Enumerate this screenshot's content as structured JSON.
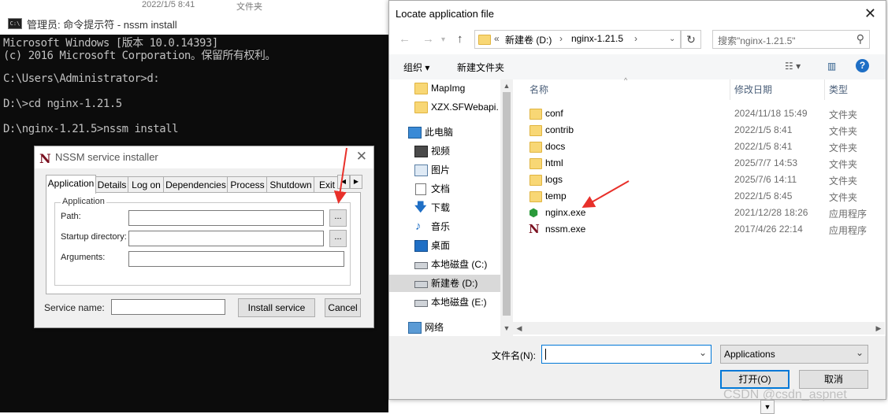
{
  "console": {
    "title": "管理员: 命令提示符 - nssm  install",
    "bg_text_left": "2022/1/5 8:41",
    "bg_text_right": "文件夹",
    "lines": [
      "Microsoft Windows [版本 10.0.14393]",
      "(c) 2016 Microsoft Corporation。保留所有权利。",
      "C:\\Users\\Administrator>d:",
      "D:\\>cd nginx-1.21.5",
      "D:\\nginx-1.21.5>nssm install"
    ]
  },
  "nssm": {
    "title": "NSSM service installer",
    "icon_letter": "N",
    "tabs": [
      "Application",
      "Details",
      "Log on",
      "Dependencies",
      "Process",
      "Shutdown",
      "Exit"
    ],
    "group_label": "Application",
    "path_label": "Path:",
    "startup_label": "Startup directory:",
    "arguments_label": "Arguments:",
    "browse_label": "...",
    "service_name_label": "Service name:",
    "install_button": "Install service",
    "cancel_button": "Cancel"
  },
  "file_dialog": {
    "title": "Locate application file",
    "breadcrumb": [
      "新建卷 (D:)",
      "nginx-1.21.5"
    ],
    "search_placeholder": "搜索\"nginx-1.21.5\"",
    "organize": "组织 ▾",
    "new_folder": "新建文件夹",
    "nav_items": [
      {
        "label": "MapImg",
        "icon": "folder-icon"
      },
      {
        "label": "XZX.SFWebapi.",
        "icon": "folder-icon"
      },
      {
        "label": "此电脑",
        "icon": "computer-icon"
      },
      {
        "label": "视频",
        "icon": "video-icon"
      },
      {
        "label": "图片",
        "icon": "pictures-icon"
      },
      {
        "label": "文档",
        "icon": "documents-icon"
      },
      {
        "label": "下载",
        "icon": "download-icon"
      },
      {
        "label": "音乐",
        "icon": "music-icon"
      },
      {
        "label": "桌面",
        "icon": "desktop-icon"
      },
      {
        "label": "本地磁盘 (C:)",
        "icon": "drive-icon"
      },
      {
        "label": "新建卷 (D:)",
        "icon": "drive-icon"
      },
      {
        "label": "本地磁盘 (E:)",
        "icon": "drive-icon"
      },
      {
        "label": "网络",
        "icon": "network-icon"
      }
    ],
    "selected_nav": "新建卷 (D:)",
    "columns": [
      "名称",
      "修改日期",
      "类型"
    ],
    "files": [
      {
        "name": "conf",
        "date": "2024/11/18 15:49",
        "type": "文件夹",
        "icon": "folder-icon"
      },
      {
        "name": "contrib",
        "date": "2022/1/5 8:41",
        "type": "文件夹",
        "icon": "folder-icon"
      },
      {
        "name": "docs",
        "date": "2022/1/5 8:41",
        "type": "文件夹",
        "icon": "folder-icon"
      },
      {
        "name": "html",
        "date": "2025/7/7 14:53",
        "type": "文件夹",
        "icon": "folder-icon"
      },
      {
        "name": "logs",
        "date": "2025/7/6 14:11",
        "type": "文件夹",
        "icon": "folder-icon"
      },
      {
        "name": "temp",
        "date": "2022/1/5 8:45",
        "type": "文件夹",
        "icon": "folder-icon"
      },
      {
        "name": "nginx.exe",
        "date": "2021/12/28 18:26",
        "type": "应用程序",
        "icon": "nginx-icon"
      },
      {
        "name": "nssm.exe",
        "date": "2017/4/26 22:14",
        "type": "应用程序",
        "icon": "nssm-icon"
      }
    ],
    "filename_label": "文件名(N):",
    "filename_value": "",
    "filetype_value": "Applications",
    "open_button": "打开(O)",
    "cancel_button": "取消"
  },
  "watermark": "CSDN @csdn_aspnet",
  "colors": {
    "console_bg": "#0c0c0c",
    "console_text": "#c0c0c0",
    "accent": "#0078d7",
    "annotation_arrow": "#e8302a"
  }
}
